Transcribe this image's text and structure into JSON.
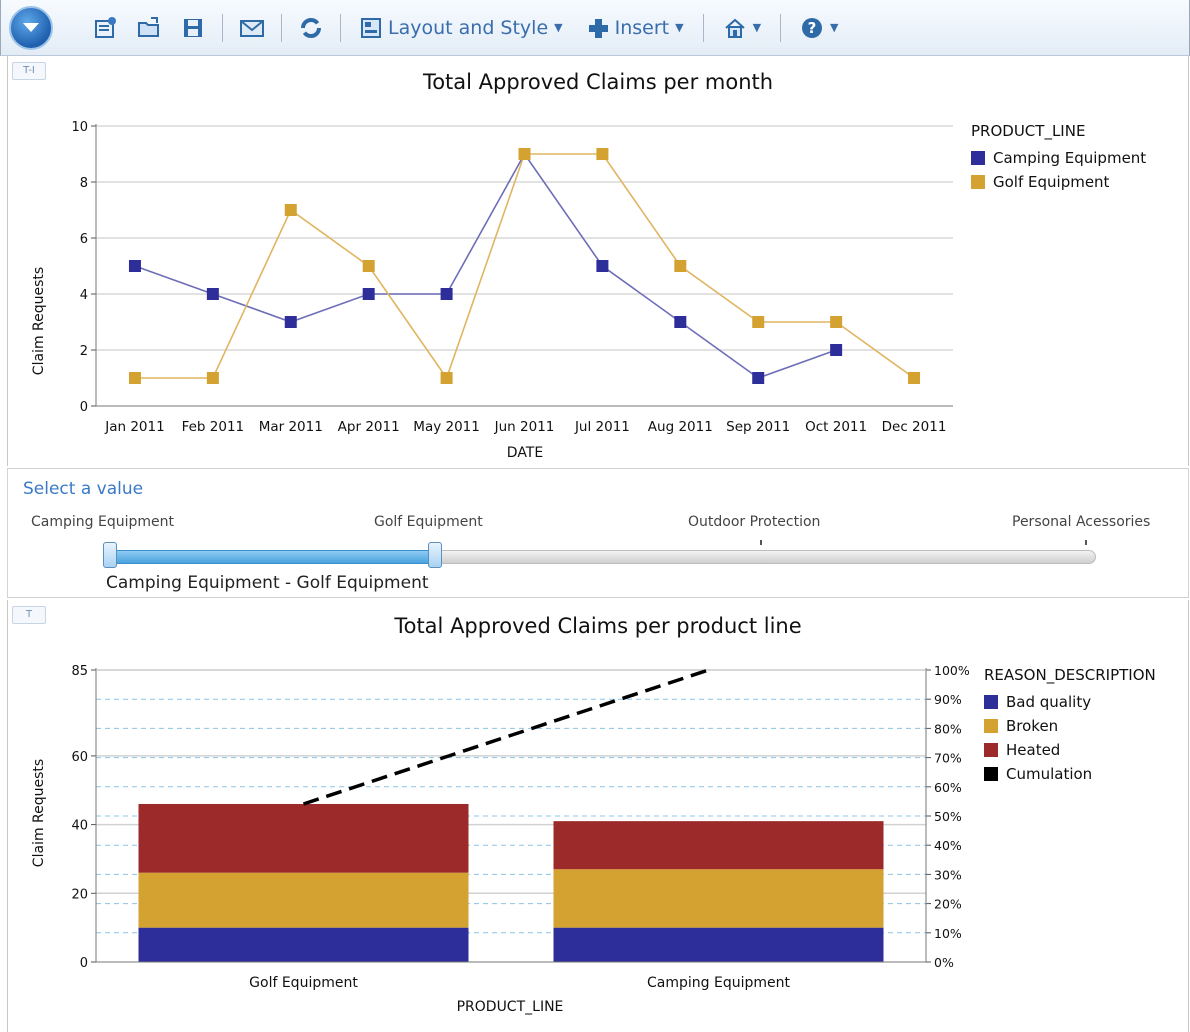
{
  "toolbar": {
    "layout_style_label": "Layout and Style",
    "insert_label": "Insert"
  },
  "panel1": {
    "tag": "T-I"
  },
  "panel3": {
    "tag": "T"
  },
  "line_chart": {
    "title": "Total Approved Claims per month",
    "xlabel": "DATE",
    "ylabel": "Claim Requests",
    "legend_title": "PRODUCT_LINE",
    "y_ticks": [
      "0",
      "2",
      "4",
      "6",
      "8",
      "10"
    ]
  },
  "slider": {
    "prompt": "Select a value",
    "ticks": [
      "Camping Equipment",
      "Golf Equipment",
      "Outdoor Protection",
      "Personal Acessories"
    ],
    "range_text": "Camping Equipment - Golf Equipment",
    "selected_range_fraction": [
      0,
      0.333
    ]
  },
  "bar_chart": {
    "title": "Total Approved Claims per product line",
    "xlabel": "PRODUCT_LINE",
    "ylabel": "Claim Requests",
    "legend_title": "REASON_DESCRIPTION",
    "y_ticks": [
      "0",
      "20",
      "40",
      "60",
      "85"
    ],
    "y2_ticks": [
      "0%",
      "10%",
      "20%",
      "30%",
      "40%",
      "50%",
      "60%",
      "70%",
      "80%",
      "90%",
      "100%"
    ]
  },
  "chart_data": [
    {
      "type": "line",
      "title": "Total Approved Claims per month",
      "xlabel": "DATE",
      "ylabel": "Claim Requests",
      "categories": [
        "Jan 2011",
        "Feb 2011",
        "Mar 2011",
        "Apr 2011",
        "May 2011",
        "Jun 2011",
        "Jul 2011",
        "Aug 2011",
        "Sep 2011",
        "Oct 2011",
        "Dec 2011"
      ],
      "ylim": [
        0,
        10
      ],
      "grid": true,
      "legend": "right",
      "series": [
        {
          "name": "Camping Equipment",
          "color": "#2e2e9a",
          "values": [
            5,
            4,
            3,
            4,
            4,
            9,
            5,
            3,
            1,
            2,
            null
          ]
        },
        {
          "name": "Golf Equipment",
          "color": "#d4a230",
          "values": [
            1,
            1,
            7,
            5,
            1,
            9,
            9,
            5,
            3,
            3,
            1
          ]
        }
      ]
    },
    {
      "type": "bar",
      "stacked": true,
      "title": "Total Approved Claims per product line",
      "xlabel": "PRODUCT_LINE",
      "ylabel": "Claim Requests",
      "categories": [
        "Golf Equipment",
        "Camping Equipment"
      ],
      "ylim": [
        0,
        85
      ],
      "y2lim": [
        0,
        100
      ],
      "legend": "right",
      "series": [
        {
          "name": "Bad quality",
          "color": "#2e2e9a",
          "values": [
            10,
            10
          ]
        },
        {
          "name": "Broken",
          "color": "#d4a230",
          "values": [
            16,
            17
          ]
        },
        {
          "name": "Heated",
          "color": "#9c2a2a",
          "values": [
            20,
            14
          ]
        }
      ],
      "cumulation": {
        "name": "Cumulation",
        "color": "#000000",
        "values": [
          54,
          100
        ]
      }
    }
  ]
}
